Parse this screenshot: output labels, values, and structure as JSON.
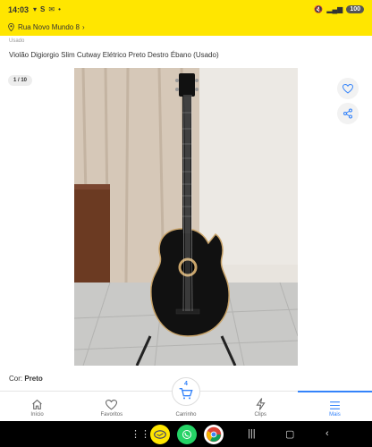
{
  "status_bar": {
    "time": "14:03",
    "battery": "100"
  },
  "location": {
    "address": "Rua Novo Mundo 8"
  },
  "product": {
    "condition": "Usado",
    "title": "Violão Digiorgio Slim Cutway Elétrico Preto Destro Ébano (Usado)",
    "image_counter": "1 / 10",
    "color_label": "Cor:",
    "color_value": "Preto"
  },
  "bottom_nav": {
    "items": [
      {
        "label": "Início",
        "icon": "home-icon"
      },
      {
        "label": "Favoritos",
        "icon": "heart-icon"
      },
      {
        "label": "Carrinho",
        "icon": "cart-icon",
        "count": "4"
      },
      {
        "label": "Clips",
        "icon": "clips-icon"
      },
      {
        "label": "Mais",
        "icon": "menu-icon"
      }
    ],
    "active": "Mais"
  },
  "colors": {
    "brand_yellow": "#ffe600",
    "accent_blue": "#3483fa"
  }
}
